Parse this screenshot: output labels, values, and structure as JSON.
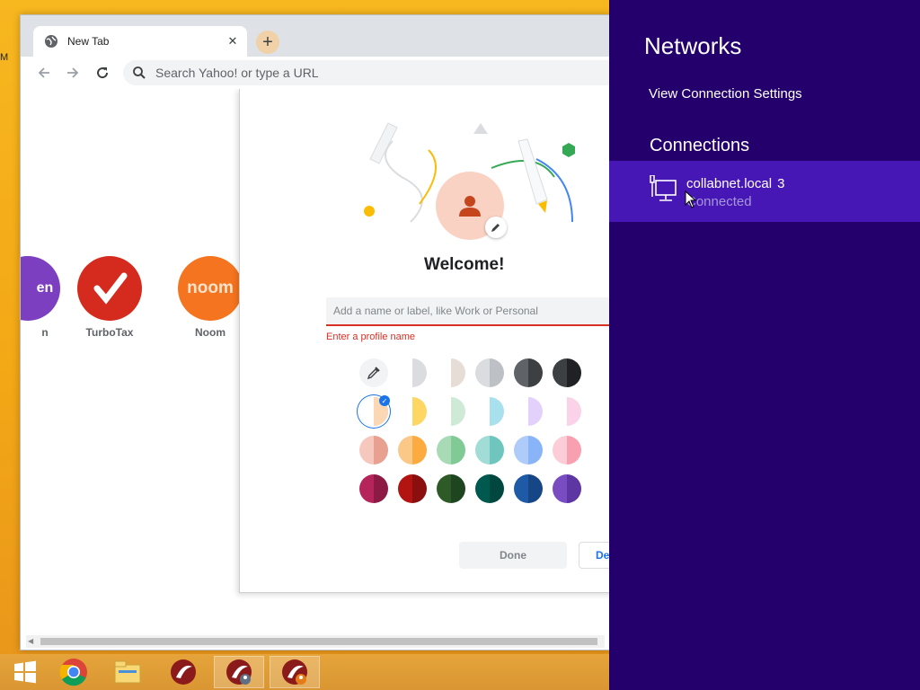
{
  "browser": {
    "tab": {
      "title": "New Tab",
      "close_glyph": "✕"
    },
    "new_tab_glyph": "+",
    "omnibox": {
      "placeholder": "Search Yahoo! or type a URL"
    },
    "shortcuts": [
      {
        "label": "n",
        "logo": "en",
        "color": "#7b3fbf"
      },
      {
        "label": "TurboTax",
        "color": "#d52b1e"
      },
      {
        "label": "Noom",
        "logo": "noom",
        "color": "#f5741f"
      }
    ],
    "profile_dialog": {
      "welcome": "Welcome!",
      "name_placeholder": "Add a name or label, like Work or Personal",
      "error": "Enter a profile name",
      "done_label": "Done",
      "second_button_label": "De",
      "color_rows": [
        [
          [
            "picker",
            "picker"
          ],
          [
            "#ffffff",
            "#dadce0"
          ],
          [
            "#ffffff",
            "#e6ddd6"
          ],
          [
            "#dadce0",
            "#bdc1c6"
          ],
          [
            "#5f6368",
            "#3c4043"
          ],
          [
            "#3c4043",
            "#202124"
          ]
        ],
        [
          [
            "#ffffff",
            "#fbd7b3"
          ],
          [
            "#ffffff",
            "#fdd663"
          ],
          [
            "#ffffff",
            "#ceead6"
          ],
          [
            "#ffffff",
            "#a8e0ee"
          ],
          [
            "#ffffff",
            "#e4d1fb"
          ],
          [
            "#ffffff",
            "#fbd3e9"
          ]
        ],
        [
          [
            "#f6c8bd",
            "#e8a090"
          ],
          [
            "#fcc888",
            "#fbab3f"
          ],
          [
            "#a8dab5",
            "#81c995"
          ],
          [
            "#a1dcd6",
            "#6ec6be"
          ],
          [
            "#aecbfa",
            "#8ab4f8"
          ],
          [
            "#fccdd6",
            "#f8a0b0"
          ]
        ],
        [
          [
            "#b5245a",
            "#8c1a44"
          ],
          [
            "#b31412",
            "#8a0f0e"
          ],
          [
            "#2d5a27",
            "#1f4420"
          ],
          [
            "#00594f",
            "#004740"
          ],
          [
            "#1e5aa6",
            "#164685"
          ],
          [
            "#7a4cc2",
            "#5e36a3"
          ]
        ]
      ]
    }
  },
  "taskbar": {
    "items": [
      "start-button",
      "chrome-app",
      "file-explorer-app",
      "security-app",
      "security-user-app",
      "security-alert-app"
    ]
  },
  "networks": {
    "title": "Networks",
    "view_settings": "View Connection Settings",
    "connections_heading": "Connections",
    "connection": {
      "name": "collabnet.local",
      "count": "3",
      "status": "Connected"
    }
  }
}
